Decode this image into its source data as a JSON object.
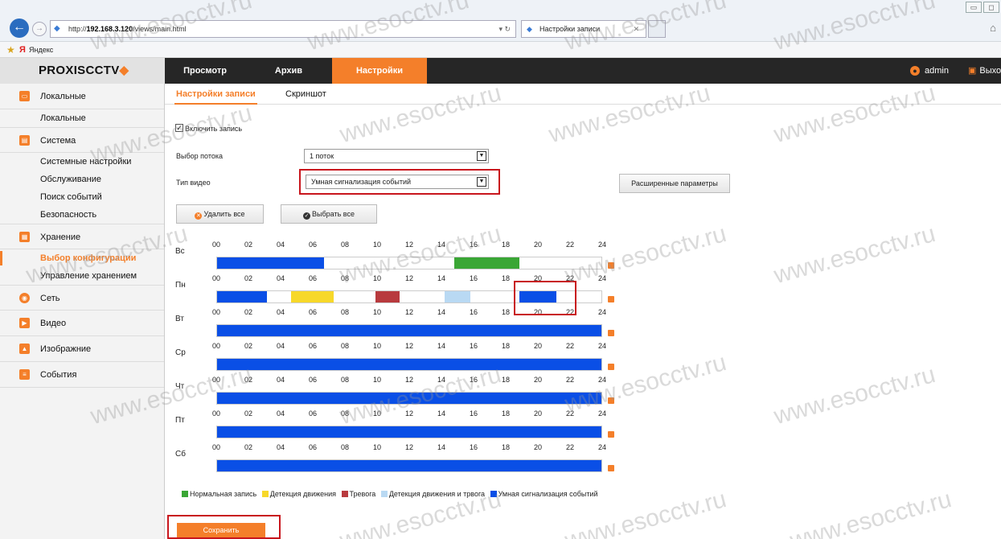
{
  "browser": {
    "url_prefix": "http://",
    "url_host": "192.168.3.120",
    "url_path": "/views/main.html",
    "tab_title": "Настройки записи",
    "favorite": "Яндекс"
  },
  "app": {
    "logo": "PROXISCCTV",
    "nav": [
      "Просмотр",
      "Архив",
      "Настройки"
    ],
    "user": "admin",
    "exit": "Выход"
  },
  "sidebar": {
    "g_local": "Локальные",
    "i_local": "Локальные",
    "g_system": "Система",
    "i_sysset": "Системные настройки",
    "i_maint": "Обслуживание",
    "i_events": "Поиск событий",
    "i_security": "Безопасность",
    "g_storage": "Хранение",
    "i_config": "Выбор конфигурации",
    "i_storage_mgmt": "Управление хранением",
    "g_net": "Сеть",
    "g_video": "Видео",
    "g_image": "Изображние",
    "g_events": "События"
  },
  "subtabs": [
    "Настройки записи",
    "Скриншот"
  ],
  "form": {
    "enable_record": "Включить запись",
    "stream_label": "Выбор потока",
    "stream_value": "1 поток",
    "video_type_label": "Тип видео",
    "video_type_value": "Умная сигнализация событий",
    "advanced": "Расширенные параметры",
    "delete_all": "Удалить все",
    "select_all": "Выбрать все",
    "save": "Сохранить"
  },
  "schedule": {
    "hours": [
      "00",
      "02",
      "04",
      "06",
      "08",
      "10",
      "12",
      "14",
      "16",
      "18",
      "20",
      "22",
      "24"
    ],
    "days": [
      {
        "name": "Вс",
        "segments": [
          {
            "start": 0,
            "end": 6.7,
            "type": "smart"
          },
          {
            "start": 14.8,
            "end": 18.9,
            "type": "normal"
          }
        ]
      },
      {
        "name": "Пн",
        "segments": [
          {
            "start": 0,
            "end": 3.1,
            "type": "smart"
          },
          {
            "start": 4.6,
            "end": 7.3,
            "type": "motion"
          },
          {
            "start": 9.9,
            "end": 11.4,
            "type": "alarm"
          },
          {
            "start": 14.2,
            "end": 15.8,
            "type": "motion_alarm"
          },
          {
            "start": 18.9,
            "end": 21.2,
            "type": "smart"
          }
        ]
      },
      {
        "name": "Вт",
        "segments": [
          {
            "start": 0,
            "end": 24,
            "type": "smart"
          }
        ]
      },
      {
        "name": "Ср",
        "segments": [
          {
            "start": 0,
            "end": 24,
            "type": "smart"
          }
        ]
      },
      {
        "name": "Чт",
        "segments": [
          {
            "start": 0,
            "end": 24,
            "type": "smart"
          }
        ]
      },
      {
        "name": "Пт",
        "segments": [
          {
            "start": 0,
            "end": 24,
            "type": "smart"
          }
        ]
      },
      {
        "name": "Сб",
        "segments": [
          {
            "start": 0,
            "end": 24,
            "type": "smart"
          }
        ]
      }
    ]
  },
  "legend": [
    {
      "key": "normal",
      "label": "Нормальная запись"
    },
    {
      "key": "motion",
      "label": "Детекция движения"
    },
    {
      "key": "alarm",
      "label": "Тревога"
    },
    {
      "key": "motion_alarm",
      "label": "Детекция движения и трвога"
    },
    {
      "key": "smart",
      "label": "Умная сигнализация событий"
    }
  ],
  "colors": {
    "accent": "#f47f2a",
    "header": "#262626",
    "normal": "#3aa635",
    "motion": "#f7d82a",
    "alarm": "#b83a3e",
    "motion_alarm": "#b9d9f3",
    "smart": "#0a4fe6",
    "highlight": "#c8161d"
  },
  "watermark": "www.esocctv.ru",
  "icons": {
    "back": "back-arrow-icon",
    "forward": "forward-arrow-icon",
    "user": "user-icon",
    "exit": "exit-icon",
    "copy": "copy-schedule-icon",
    "delete": "delete-icon",
    "check": "check-icon"
  }
}
